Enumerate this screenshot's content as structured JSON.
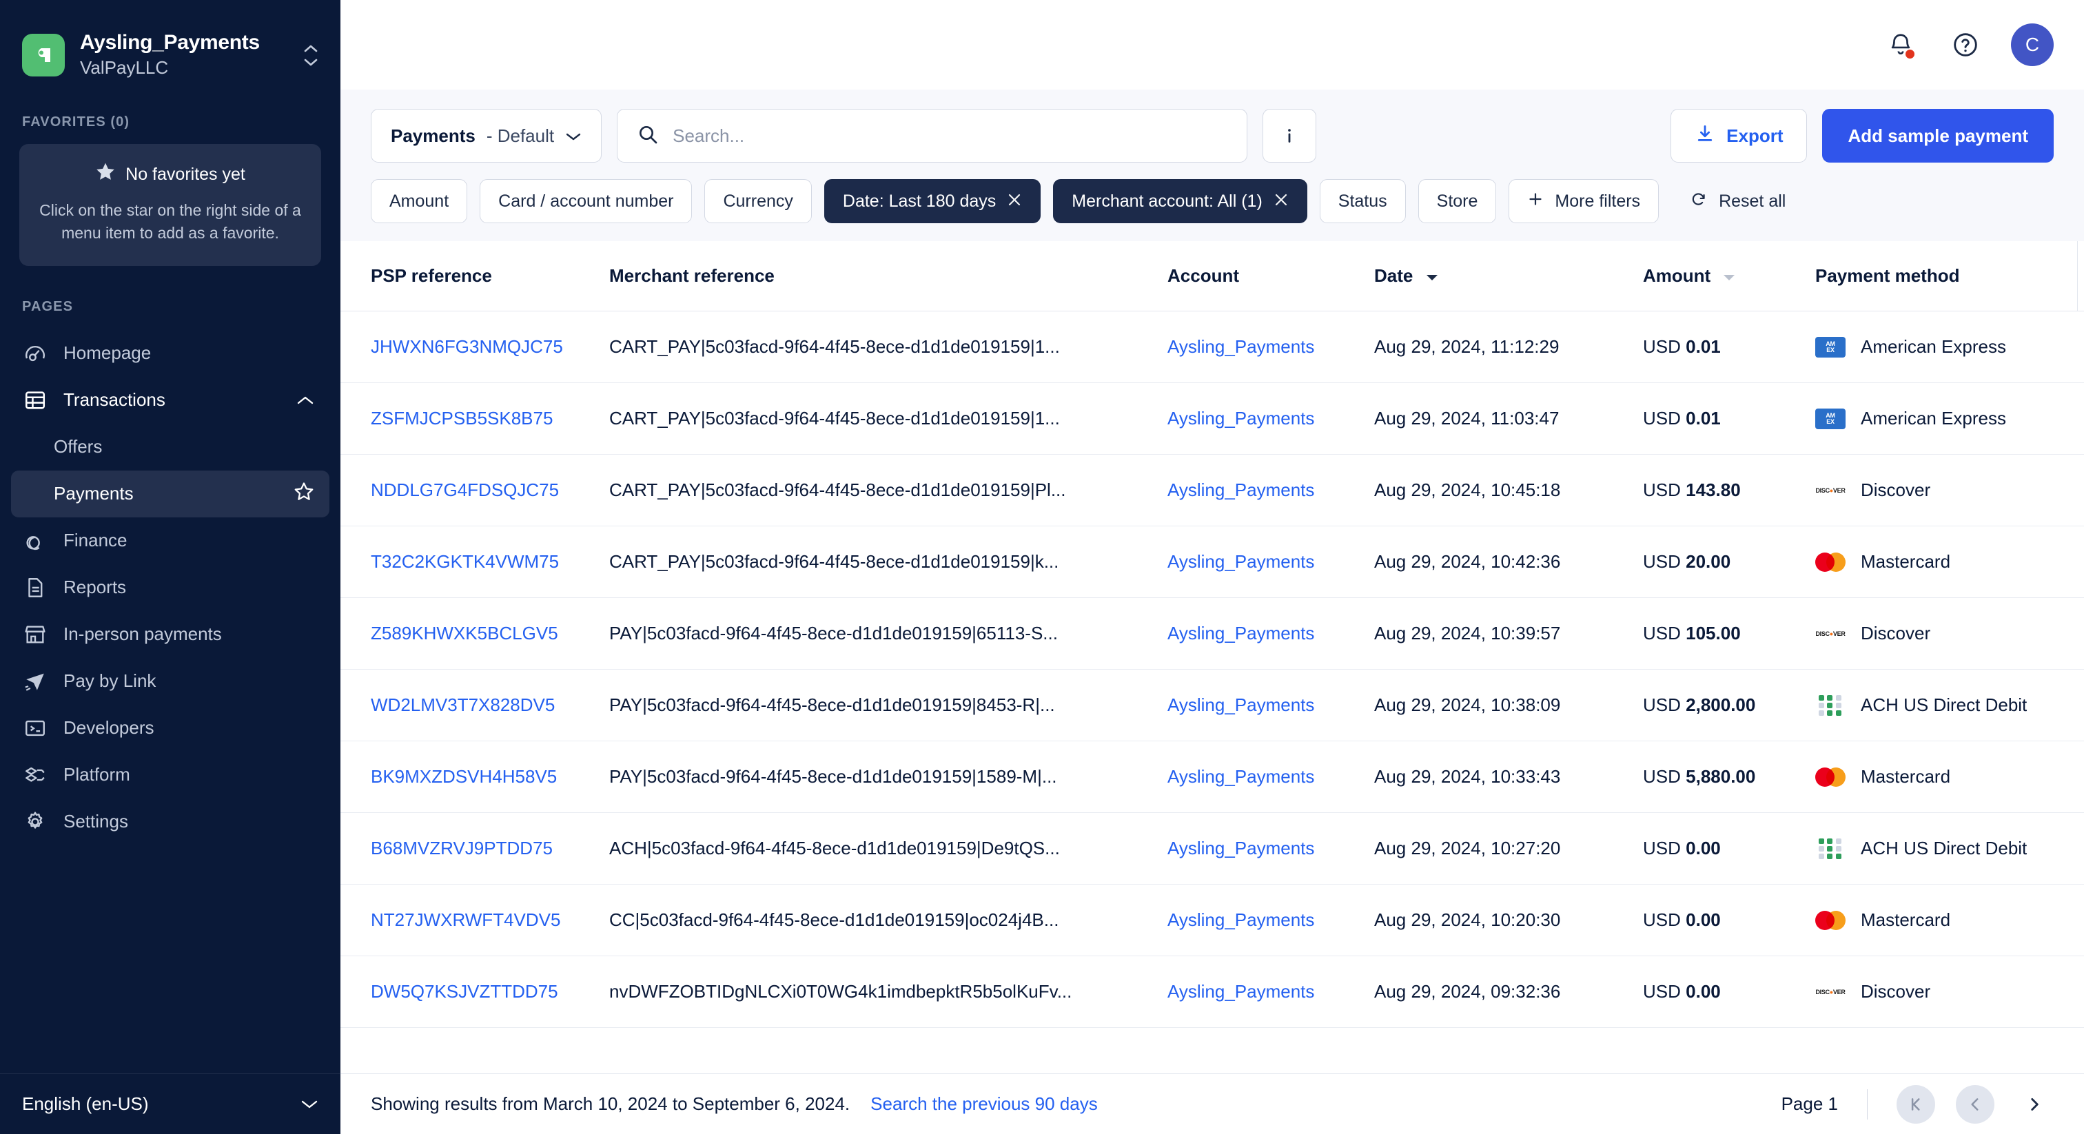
{
  "sidebar": {
    "brand": {
      "title": "Aysling_Payments",
      "subtitle": "ValPayLLC",
      "logo_letter": "a",
      "logo_color": "#52be72"
    },
    "favorites_label": "FAVORITES (0)",
    "favorites_card": {
      "title": "No favorites yet",
      "body": "Click on the star on the right side of a menu item to add as a favorite."
    },
    "pages_label": "PAGES",
    "items": [
      {
        "label": "Homepage",
        "icon": "speedometer-icon"
      },
      {
        "label": "Transactions",
        "icon": "table-icon"
      },
      {
        "label": "Offers",
        "icon": "none"
      },
      {
        "label": "Payments",
        "icon": "none"
      },
      {
        "label": "Finance",
        "icon": "coins-icon"
      },
      {
        "label": "Reports",
        "icon": "document-icon"
      },
      {
        "label": "In-person payments",
        "icon": "storefront-icon"
      },
      {
        "label": "Pay by Link",
        "icon": "paper-plane-icon"
      },
      {
        "label": "Developers",
        "icon": "terminal-icon"
      },
      {
        "label": "Platform",
        "icon": "layers-icon"
      },
      {
        "label": "Settings",
        "icon": "gear-icon"
      }
    ],
    "language": "English (en-US)"
  },
  "header": {
    "avatar_initial": "C",
    "notification_badge": true
  },
  "toolbar": {
    "view_name": "Payments",
    "view_variant": "- Default",
    "search_placeholder": "Search...",
    "search_value": "",
    "info_label": "i",
    "export_label": "Export",
    "add_sample_label": "Add sample payment"
  },
  "filters": [
    {
      "label": "Amount",
      "active": false,
      "removable": false
    },
    {
      "label": "Card / account number",
      "active": false,
      "removable": false
    },
    {
      "label": "Currency",
      "active": false,
      "removable": false
    },
    {
      "label": "Date: Last 180 days",
      "active": true,
      "removable": true
    },
    {
      "label": "Merchant account: All (1)",
      "active": true,
      "removable": true
    },
    {
      "label": "Status",
      "active": false,
      "removable": false
    },
    {
      "label": "Store",
      "active": false,
      "removable": false
    },
    {
      "label": "More filters",
      "active": false,
      "removable": false,
      "icon": "plus-icon"
    },
    {
      "label": "Reset all",
      "active": false,
      "removable": false,
      "icon": "refresh-icon",
      "plain": true
    }
  ],
  "table": {
    "columns": [
      {
        "key": "psp",
        "label": "PSP reference"
      },
      {
        "key": "mref",
        "label": "Merchant reference"
      },
      {
        "key": "account",
        "label": "Account"
      },
      {
        "key": "date",
        "label": "Date",
        "sort": "desc"
      },
      {
        "key": "amount",
        "label": "Amount",
        "sort": "none"
      },
      {
        "key": "method",
        "label": "Payment method"
      }
    ],
    "settings_icon": "gear-icon",
    "rows": [
      {
        "psp": "JHWXN6FG3NMQJC75",
        "mref": "CART_PAY|5c03facd-9f64-4f45-8ece-d1d1de019159|1...",
        "account": "Aysling_Payments",
        "date": "Aug 29, 2024, 11:12:29",
        "currency": "USD",
        "amount": "0.01",
        "method": "American Express",
        "brand": "amex"
      },
      {
        "psp": "ZSFMJCPSB5SK8B75",
        "mref": "CART_PAY|5c03facd-9f64-4f45-8ece-d1d1de019159|1...",
        "account": "Aysling_Payments",
        "date": "Aug 29, 2024, 11:03:47",
        "currency": "USD",
        "amount": "0.01",
        "method": "American Express",
        "brand": "amex"
      },
      {
        "psp": "NDDLG7G4FDSQJC75",
        "mref": "CART_PAY|5c03facd-9f64-4f45-8ece-d1d1de019159|Pl...",
        "account": "Aysling_Payments",
        "date": "Aug 29, 2024, 10:45:18",
        "currency": "USD",
        "amount": "143.80",
        "method": "Discover",
        "brand": "discover"
      },
      {
        "psp": "T32C2KGKTK4VWM75",
        "mref": "CART_PAY|5c03facd-9f64-4f45-8ece-d1d1de019159|k...",
        "account": "Aysling_Payments",
        "date": "Aug 29, 2024, 10:42:36",
        "currency": "USD",
        "amount": "20.00",
        "method": "Mastercard",
        "brand": "mastercard"
      },
      {
        "psp": "Z589KHWXK5BCLGV5",
        "mref": "PAY|5c03facd-9f64-4f45-8ece-d1d1de019159|65113-S...",
        "account": "Aysling_Payments",
        "date": "Aug 29, 2024, 10:39:57",
        "currency": "USD",
        "amount": "105.00",
        "method": "Discover",
        "brand": "discover"
      },
      {
        "psp": "WD2LMV3T7X828DV5",
        "mref": "PAY|5c03facd-9f64-4f45-8ece-d1d1de019159|8453-R|...",
        "account": "Aysling_Payments",
        "date": "Aug 29, 2024, 10:38:09",
        "currency": "USD",
        "amount": "2,800.00",
        "method": "ACH US Direct Debit",
        "brand": "ach"
      },
      {
        "psp": "BK9MXZDSVH4H58V5",
        "mref": "PAY|5c03facd-9f64-4f45-8ece-d1d1de019159|1589-M|...",
        "account": "Aysling_Payments",
        "date": "Aug 29, 2024, 10:33:43",
        "currency": "USD",
        "amount": "5,880.00",
        "method": "Mastercard",
        "brand": "mastercard"
      },
      {
        "psp": "B68MVZRVJ9PTDD75",
        "mref": "ACH|5c03facd-9f64-4f45-8ece-d1d1de019159|De9tQS...",
        "account": "Aysling_Payments",
        "date": "Aug 29, 2024, 10:27:20",
        "currency": "USD",
        "amount": "0.00",
        "method": "ACH US Direct Debit",
        "brand": "ach"
      },
      {
        "psp": "NT27JWXRWFT4VDV5",
        "mref": "CC|5c03facd-9f64-4f45-8ece-d1d1de019159|oc024j4B...",
        "account": "Aysling_Payments",
        "date": "Aug 29, 2024, 10:20:30",
        "currency": "USD",
        "amount": "0.00",
        "method": "Mastercard",
        "brand": "mastercard"
      },
      {
        "psp": "DW5Q7KSJVZTTDD75",
        "mref": "nvDWFZOBTIDgNLCXi0T0WG4k1imdbepktR5b5olKuFv...",
        "account": "Aysling_Payments",
        "date": "Aug 29, 2024, 09:32:36",
        "currency": "USD",
        "amount": "0.00",
        "method": "Discover",
        "brand": "discover"
      }
    ]
  },
  "footer": {
    "results_text": "Showing results from March 10, 2024 to September 6, 2024.",
    "previous_link": "Search the previous 90 days",
    "page_label": "Page 1"
  },
  "colors": {
    "sidebar_bg": "#0a1938",
    "accent_blue": "#3055eb",
    "link_blue": "#2460f0",
    "chip_dark": "#1c2a4a",
    "brand_green": "#52be72"
  }
}
